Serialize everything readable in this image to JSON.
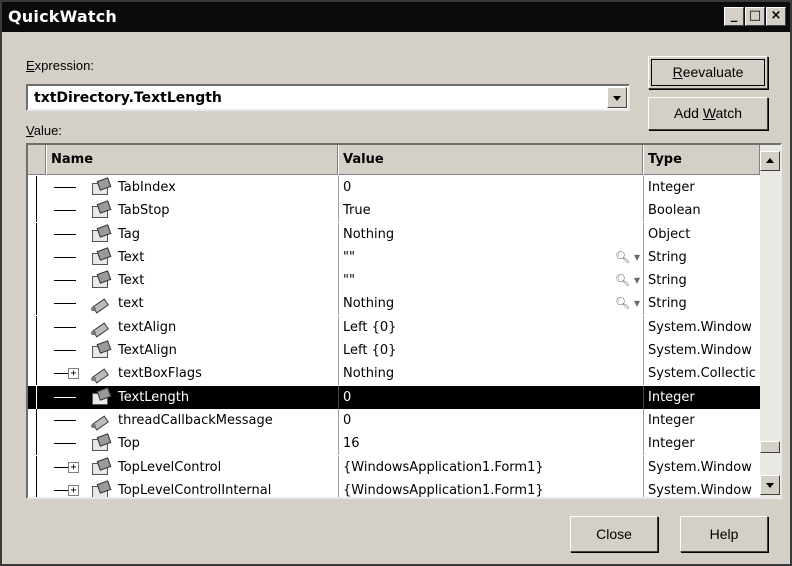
{
  "window": {
    "title": "QuickWatch",
    "min_glyph": "_",
    "max_glyph": "□",
    "close_glyph": "×"
  },
  "expression": {
    "label_prefix": "",
    "label_accel": "E",
    "label_rest": "xpression:",
    "value": "txtDirectory.TextLength"
  },
  "value_label": {
    "accel": "V",
    "rest": "alue:"
  },
  "buttons": {
    "reevaluate_accel": "R",
    "reevaluate_rest": "eevaluate",
    "add_watch_pre": "Add ",
    "add_watch_accel": "W",
    "add_watch_rest": "atch",
    "close": "Close",
    "help": "Help"
  },
  "grid": {
    "columns": [
      "Name",
      "Value",
      "Type"
    ],
    "rows": [
      {
        "name": "TabIndex",
        "value": "0",
        "type": "Integer",
        "icon": "property-icon",
        "expand": false,
        "mag": false
      },
      {
        "name": "TabStop",
        "value": "True",
        "type": "Boolean",
        "icon": "property-icon",
        "expand": false,
        "mag": false
      },
      {
        "name": "Tag",
        "value": "Nothing",
        "type": "Object",
        "icon": "property-icon",
        "expand": false,
        "mag": false
      },
      {
        "name": "Text",
        "value": "\"\"",
        "type": "String",
        "icon": "property-icon",
        "expand": false,
        "mag": true
      },
      {
        "name": "Text",
        "value": "\"\"",
        "type": "String",
        "icon": "property-icon",
        "expand": false,
        "mag": true
      },
      {
        "name": "text",
        "value": "Nothing",
        "type": "String",
        "icon": "field-icon",
        "expand": false,
        "mag": true
      },
      {
        "name": "textAlign",
        "value": "Left {0}",
        "type": "System.Window",
        "icon": "field-icon",
        "expand": false,
        "mag": false
      },
      {
        "name": "TextAlign",
        "value": "Left {0}",
        "type": "System.Window",
        "icon": "property-icon",
        "expand": false,
        "mag": false
      },
      {
        "name": "textBoxFlags",
        "value": "Nothing",
        "type": "System.Collectic",
        "icon": "field-icon",
        "expand": true,
        "mag": false
      },
      {
        "name": "TextLength",
        "value": "0",
        "type": "Integer",
        "icon": "property-icon",
        "expand": false,
        "mag": false,
        "selected": true
      },
      {
        "name": "threadCallbackMessage",
        "value": "0",
        "type": "Integer",
        "icon": "field-icon",
        "expand": false,
        "mag": false
      },
      {
        "name": "Top",
        "value": "16",
        "type": "Integer",
        "icon": "property-icon",
        "expand": false,
        "mag": false
      },
      {
        "name": "TopLevelControl",
        "value": "{WindowsApplication1.Form1}",
        "type": "System.Window",
        "icon": "property-icon",
        "expand": true,
        "mag": false
      },
      {
        "name": "TopLevelControlInternal",
        "value": "{WindowsApplication1.Form1}",
        "type": "System.Window",
        "icon": "property-icon",
        "expand": true,
        "mag": false
      }
    ],
    "magnifier_glyph": "🔍︎ ▾"
  }
}
